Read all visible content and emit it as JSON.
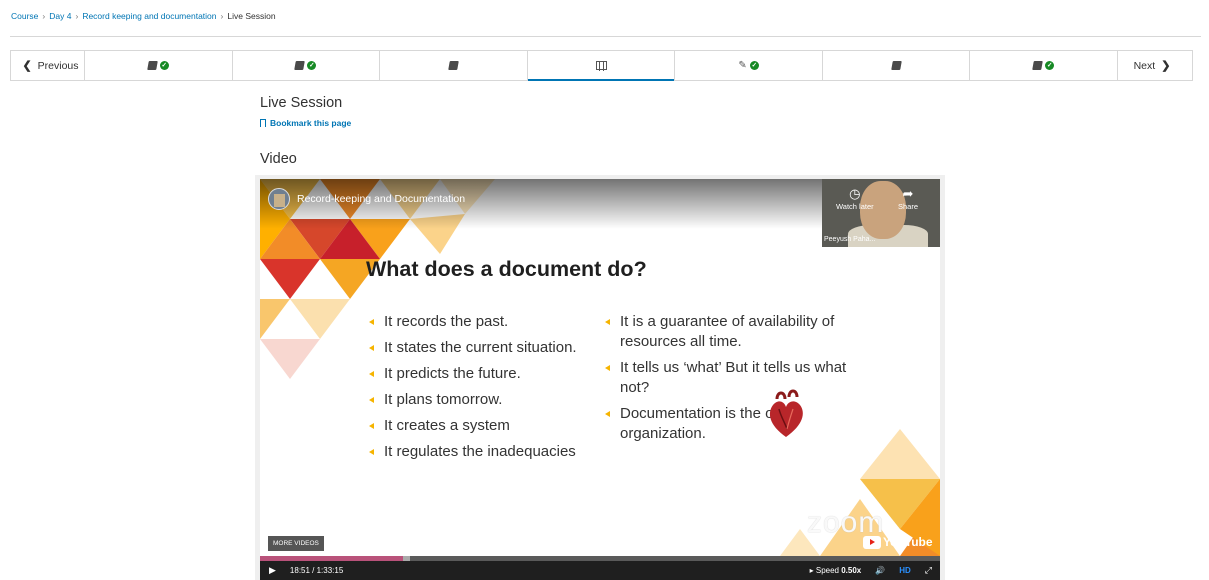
{
  "breadcrumb": {
    "items": [
      "Course",
      "Day 4",
      "Record keeping and documentation"
    ],
    "current": "Live Session",
    "separator": "›"
  },
  "sequence_nav": {
    "previous_label": "Previous",
    "next_label": "Next",
    "tabs": [
      {
        "icon": "book-icon",
        "completed": true
      },
      {
        "icon": "book-icon",
        "completed": true
      },
      {
        "icon": "book-icon",
        "completed": false
      },
      {
        "icon": "film-icon",
        "completed": false,
        "active": true
      },
      {
        "icon": "edit-icon",
        "completed": true
      },
      {
        "icon": "book-icon",
        "completed": false
      },
      {
        "icon": "book-icon",
        "completed": true
      }
    ]
  },
  "unit": {
    "title": "Live Session",
    "bookmark_label": "Bookmark this page",
    "section_title": "Video"
  },
  "video": {
    "title": "Record-keeping and Documentation",
    "presenter_name": "Peeyush Paha...",
    "watch_later_label": "Watch later",
    "share_label": "Share",
    "more_videos_label": "MORE VIDEOS",
    "slide": {
      "heading": "What does a document do?",
      "left_bullets": [
        "It records the past.",
        "It states the current situation.",
        "It predicts the future.",
        "It plans tomorrow.",
        "It creates a system",
        "It regulates the inadequacies"
      ],
      "right_bullets": [
        "It is a guarantee of availability of resources all time.",
        "It tells us ‘what’ But it tells us what not?",
        "Documentation is the of the organization."
      ]
    },
    "watermark": "zoom",
    "youtube_label": "YouTube",
    "controls": {
      "play_symbol": "▶",
      "time": "18:51 / 1:33:15",
      "speed_label": "Speed",
      "speed_value": "0.50x",
      "volume_symbol": "🔊",
      "hd_label": "HD",
      "fullscreen_symbol": "⤢",
      "progress_played": 0.21,
      "progress_loaded": 0.22
    }
  },
  "colors": {
    "link": "#0075b4",
    "check": "#178a25",
    "progress": "#b9527a",
    "hd": "#2a90ff"
  }
}
